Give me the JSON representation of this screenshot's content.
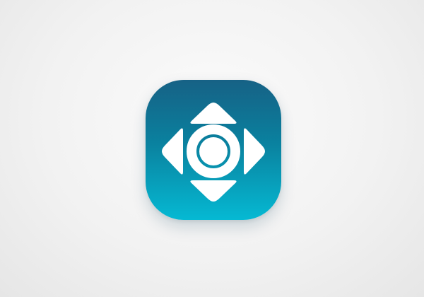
{
  "app_icon": {
    "icon": "directional-pad-icon",
    "colors": {
      "gradient_top": "#08587e",
      "gradient_mid": "#0a86a3",
      "gradient_bottom": "#05b9d3",
      "glyph": "#ffffff"
    }
  }
}
